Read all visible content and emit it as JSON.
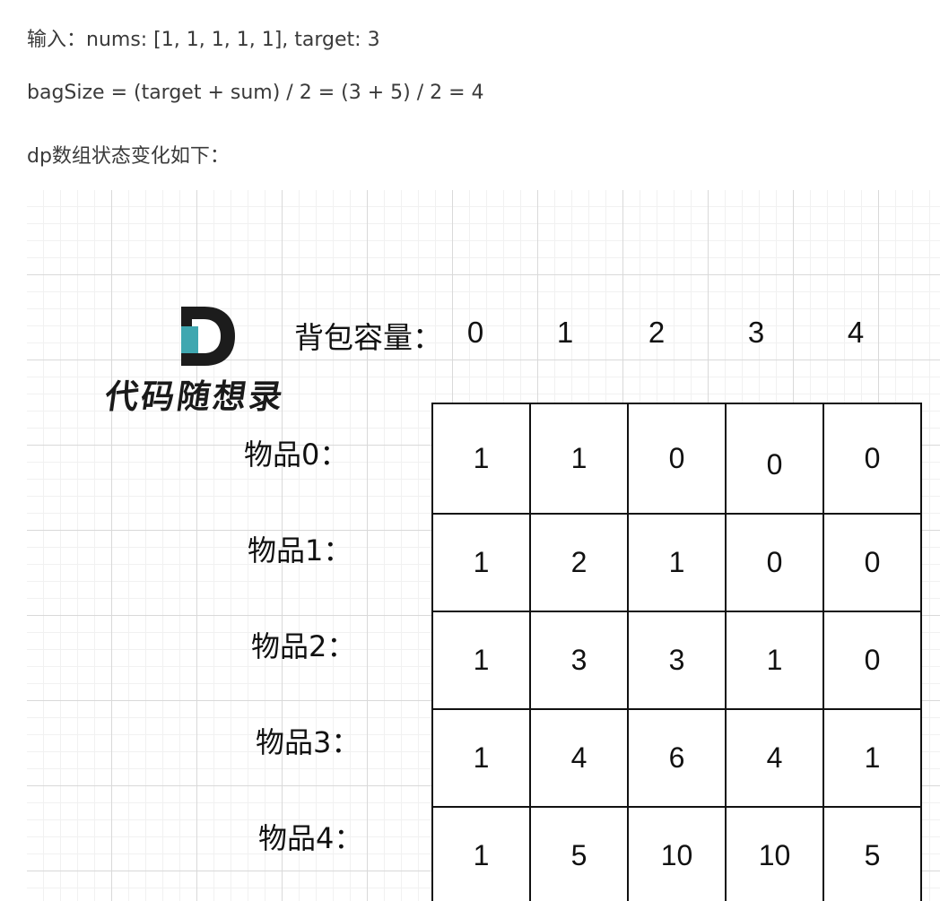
{
  "text": {
    "input_line": "输入：nums: [1, 1, 1, 1, 1], target: 3",
    "bagsize_line": "bagSize = (target + sum) / 2 = (3 + 5) / 2 = 4",
    "dp_line": "dp数组状态变化如下："
  },
  "figure": {
    "logo_text": "代码随想录",
    "capacity_label": "背包容量：",
    "capacities": [
      "0",
      "1",
      "2",
      "3",
      "4"
    ],
    "items": [
      "物品0：",
      "物品1：",
      "物品2：",
      "物品3：",
      "物品4："
    ],
    "dp_table": [
      [
        "1",
        "1",
        "0",
        "0",
        "0"
      ],
      [
        "1",
        "2",
        "1",
        "0",
        "0"
      ],
      [
        "1",
        "3",
        "3",
        "1",
        "0"
      ],
      [
        "1",
        "4",
        "6",
        "4",
        "1"
      ],
      [
        "1",
        "5",
        "10",
        "10",
        "5"
      ]
    ],
    "colors": {
      "logo_dark": "#1c1c1c",
      "logo_teal": "#3fa7b0",
      "grid_major": "#d9d9d9",
      "grid_minor": "#f1f1f1"
    }
  }
}
